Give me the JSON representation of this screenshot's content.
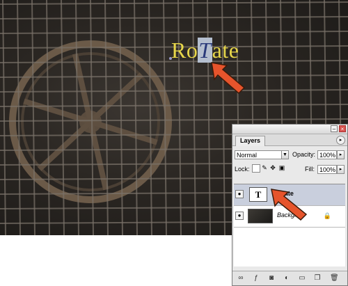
{
  "canvas": {
    "text_before": "Ro",
    "text_selected": "T",
    "text_after": "ate"
  },
  "layers_panel": {
    "tab_label": "Layers",
    "blend_mode": "Normal",
    "opacity_label": "Opacity:",
    "opacity_value": "100%",
    "lock_label": "Lock:",
    "fill_label": "Fill:",
    "fill_value": "100%",
    "layers": [
      {
        "name": "RoTate",
        "thumb_glyph": "T"
      },
      {
        "name": "Backgr"
      }
    ]
  },
  "colors": {
    "canvas_text": "#e7d64a",
    "arrow": "#e6542c",
    "selected_layer": "#c9cfdd"
  },
  "icons": [
    "eye-icon",
    "type-layer-icon",
    "lock-icon",
    "link-icon",
    "layer-style-icon",
    "mask-icon",
    "adjustment-icon",
    "folder-icon",
    "new-layer-icon",
    "trash-icon"
  ]
}
